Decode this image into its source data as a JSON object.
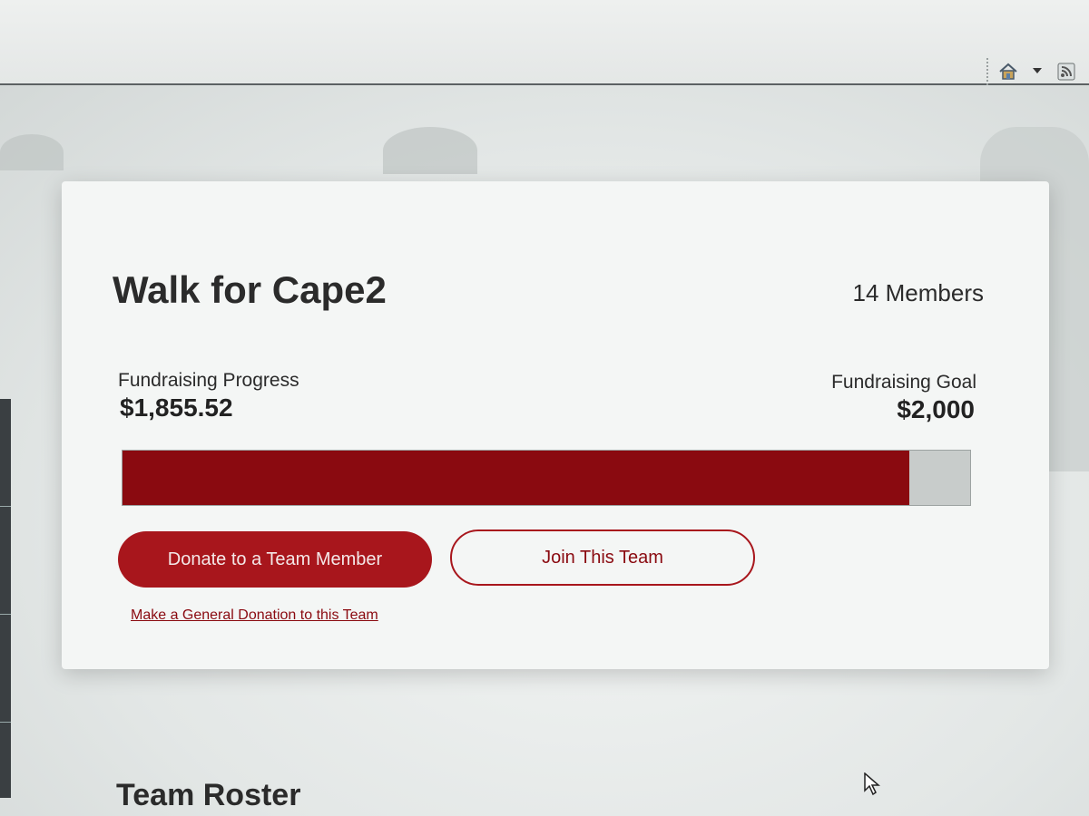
{
  "browser": {
    "toolbar_icons": [
      "home-icon",
      "dropdown-arrow-icon",
      "rss-feed-icon"
    ]
  },
  "team": {
    "name": "Walk for Cape2",
    "members": "14 Members"
  },
  "fundraising": {
    "progress_label": "Fundraising Progress",
    "progress_amount": "$1,855.52",
    "goal_label": "Fundraising Goal",
    "goal_amount": "$2,000",
    "progress_fraction": 0.9278
  },
  "actions": {
    "donate_label": "Donate to a Team Member",
    "join_label": "Join This Team",
    "general_donation_label": "Make a General Donation to this Team"
  },
  "roster": {
    "heading": "Team Roster"
  },
  "colors": {
    "accent": "#a8161c",
    "progress_fill": "#8a0a10",
    "progress_track": "#c8cccb"
  }
}
